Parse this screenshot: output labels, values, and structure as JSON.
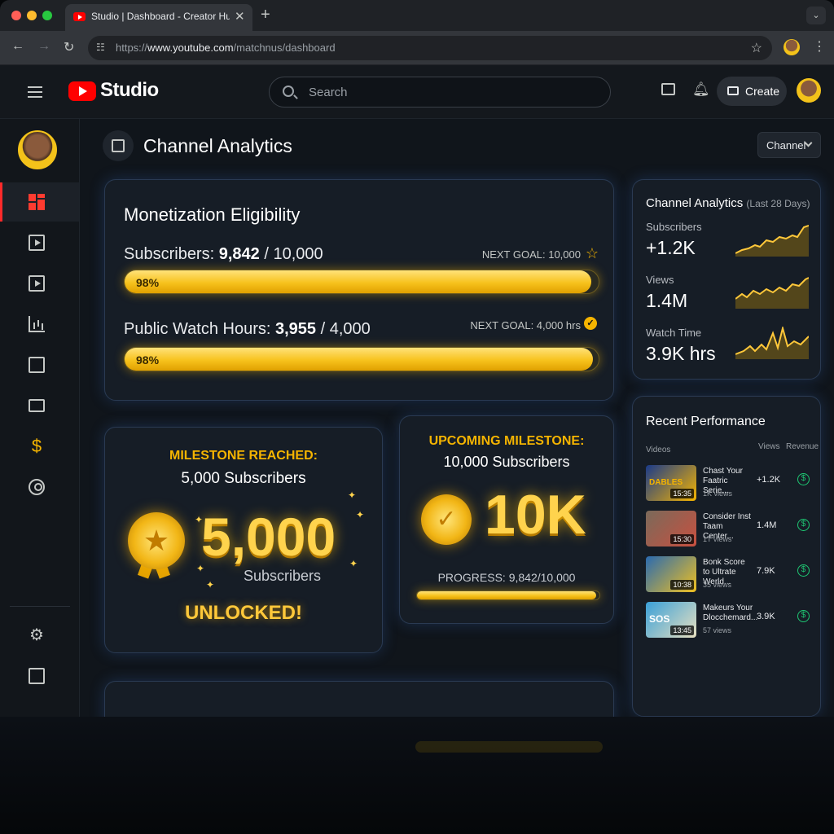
{
  "browser": {
    "tab_title": "Studio | Dashboard - Creator Hub",
    "url_prefix": "https://",
    "url_host": "www.youtube.com",
    "url_path": "/matchnus/dashboard"
  },
  "header": {
    "logo_text": "Studio",
    "search_placeholder": "Search",
    "create_label": "Create"
  },
  "sidebar": {
    "items": [
      "dashboard",
      "content",
      "playlists",
      "analytics",
      "comments",
      "subtitles",
      "earn",
      "customization",
      "settings",
      "send-feedback"
    ],
    "active": "dashboard"
  },
  "main": {
    "title": "Channel Analytics",
    "channel_dropdown": "Channel"
  },
  "monetization": {
    "title": "Monetization Eligibility",
    "subscribers": {
      "label": "Subscribers:",
      "current": "9,842",
      "target": "/ 10,000",
      "next_goal": "NEXT GOAL: 10,000",
      "percent_label": "98%",
      "fraction": 0.9842
    },
    "watch_hours": {
      "label": "Public Watch Hours:",
      "current": "3,955",
      "target": "/ 4,000",
      "next_goal": "NEXT GOAL: 4,000 hrs",
      "percent_label": "98%",
      "fraction": 0.98875
    }
  },
  "analytics_card": {
    "title": "Channel Analytics",
    "period": "(Last 28 Days)",
    "metrics": [
      {
        "label": "Subscribers",
        "value": "+1.2K"
      },
      {
        "label": "Views",
        "value": "1.4M"
      },
      {
        "label": "Watch Time",
        "value": "3.9K hrs"
      }
    ]
  },
  "milestone_reached": {
    "heading": "MILESTONE REACHED:",
    "subheading": "5,000 Subscribers",
    "number": "5,000",
    "caption": "Subscribers",
    "status": "UNLOCKED!"
  },
  "upcoming_milestone": {
    "heading": "UPCOMING MILESTONE:",
    "subheading": "10,000 Subscribers",
    "number": "10K",
    "progress_label": "PROGRESS: 9,842/10,000",
    "fraction": 0.9842
  },
  "recent_performance": {
    "title": "Recent Performance",
    "columns": {
      "videos": "Videos",
      "views": "Views",
      "revenue": "Revenue"
    },
    "rows": [
      {
        "title": "Chast Your Faatric Serie...",
        "sub": "1K views",
        "views": "+1.2K",
        "duration": "15:35",
        "thumb_caption": "DABLES",
        "color_a": "#1a3a8a",
        "color_b": "#f5b400"
      },
      {
        "title": "Consider Inst Taam Center...",
        "sub": "1T views",
        "views": "1.4M",
        "duration": "15:30",
        "thumb_caption": "",
        "color_a": "#7a6a5a",
        "color_b": "#c85040"
      },
      {
        "title": "Bonk Score to Ultrate Werld...",
        "sub": "35 views",
        "views": "7.9K",
        "duration": "10:38",
        "thumb_caption": "",
        "color_a": "#2a6ab0",
        "color_b": "#f0c020"
      },
      {
        "title": "Makeurs Your Dlocchemard...",
        "sub": "57 views",
        "views": "3.9K",
        "duration": "13:45",
        "thumb_caption": "SOS",
        "color_a": "#3aa0d8",
        "color_b": "#e8e0c0"
      }
    ]
  },
  "colors": {
    "accent_gold": "#f5b400",
    "brand_red": "#ff0000",
    "revenue_green": "#1ec873"
  }
}
